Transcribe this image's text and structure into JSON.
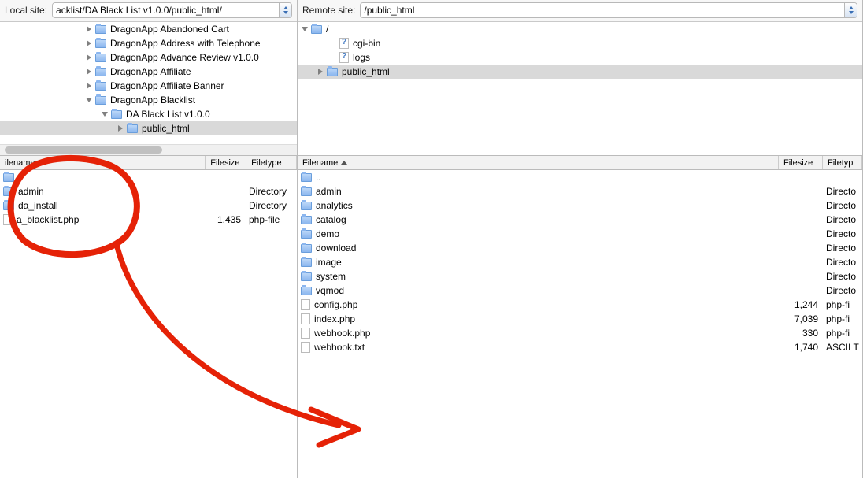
{
  "local": {
    "site_label": "Local site:",
    "site_value": "acklist/DA Black List v1.0.0/public_html/",
    "tree": [
      {
        "indent": 110,
        "expanded": false,
        "icon": "folder",
        "label": "DragonApp Abandoned Cart"
      },
      {
        "indent": 110,
        "expanded": false,
        "icon": "folder",
        "label": "DragonApp Address with Telephone"
      },
      {
        "indent": 110,
        "expanded": false,
        "icon": "folder",
        "label": "DragonApp Advance Review v1.0.0"
      },
      {
        "indent": 110,
        "expanded": false,
        "icon": "folder",
        "label": "DragonApp Affiliate"
      },
      {
        "indent": 110,
        "expanded": false,
        "icon": "folder",
        "label": "DragonApp Affiliate Banner"
      },
      {
        "indent": 110,
        "expanded": true,
        "icon": "folder",
        "label": "DragonApp Blacklist"
      },
      {
        "indent": 130,
        "expanded": true,
        "icon": "folder",
        "label": "DA Black List v1.0.0"
      },
      {
        "indent": 150,
        "expanded": false,
        "icon": "folder",
        "label": "public_html",
        "selected": true
      }
    ],
    "columns": {
      "name": "ilename",
      "size": "Filesize",
      "type": "Filetype"
    },
    "files": [
      {
        "name": "..",
        "size": "",
        "type": "",
        "icon": "folder"
      },
      {
        "name": "admin",
        "size": "",
        "type": "Directory",
        "icon": "folder"
      },
      {
        "name": "da_install",
        "size": "",
        "type": "Directory",
        "icon": "folder"
      },
      {
        "name": "a_blacklist.php",
        "size": "1,435",
        "type": "php-file",
        "icon": "file"
      }
    ]
  },
  "remote": {
    "site_label": "Remote site:",
    "site_value": "/public_html",
    "tree": [
      {
        "indent": 6,
        "expanded": true,
        "icon": "folder",
        "label": "/"
      },
      {
        "indent": 42,
        "expanded": null,
        "icon": "unknown",
        "label": "cgi-bin"
      },
      {
        "indent": 42,
        "expanded": null,
        "icon": "unknown",
        "label": "logs"
      },
      {
        "indent": 26,
        "expanded": false,
        "icon": "folder",
        "label": "public_html",
        "selected": true
      }
    ],
    "columns": {
      "name": "Filename",
      "size": "Filesize",
      "type": "Filetyp"
    },
    "files": [
      {
        "name": "..",
        "size": "",
        "type": "",
        "icon": "folder"
      },
      {
        "name": "admin",
        "size": "",
        "type": "Directo",
        "icon": "folder"
      },
      {
        "name": "analytics",
        "size": "",
        "type": "Directo",
        "icon": "folder"
      },
      {
        "name": "catalog",
        "size": "",
        "type": "Directo",
        "icon": "folder"
      },
      {
        "name": "demo",
        "size": "",
        "type": "Directo",
        "icon": "folder"
      },
      {
        "name": "download",
        "size": "",
        "type": "Directo",
        "icon": "folder"
      },
      {
        "name": "image",
        "size": "",
        "type": "Directo",
        "icon": "folder"
      },
      {
        "name": "system",
        "size": "",
        "type": "Directo",
        "icon": "folder"
      },
      {
        "name": "vqmod",
        "size": "",
        "type": "Directo",
        "icon": "folder"
      },
      {
        "name": "config.php",
        "size": "1,244",
        "type": "php-fi",
        "icon": "file"
      },
      {
        "name": "index.php",
        "size": "7,039",
        "type": "php-fi",
        "icon": "file"
      },
      {
        "name": "webhook.php",
        "size": "330",
        "type": "php-fi",
        "icon": "file"
      },
      {
        "name": "webhook.txt",
        "size": "1,740",
        "type": "ASCII T",
        "icon": "file"
      }
    ]
  }
}
